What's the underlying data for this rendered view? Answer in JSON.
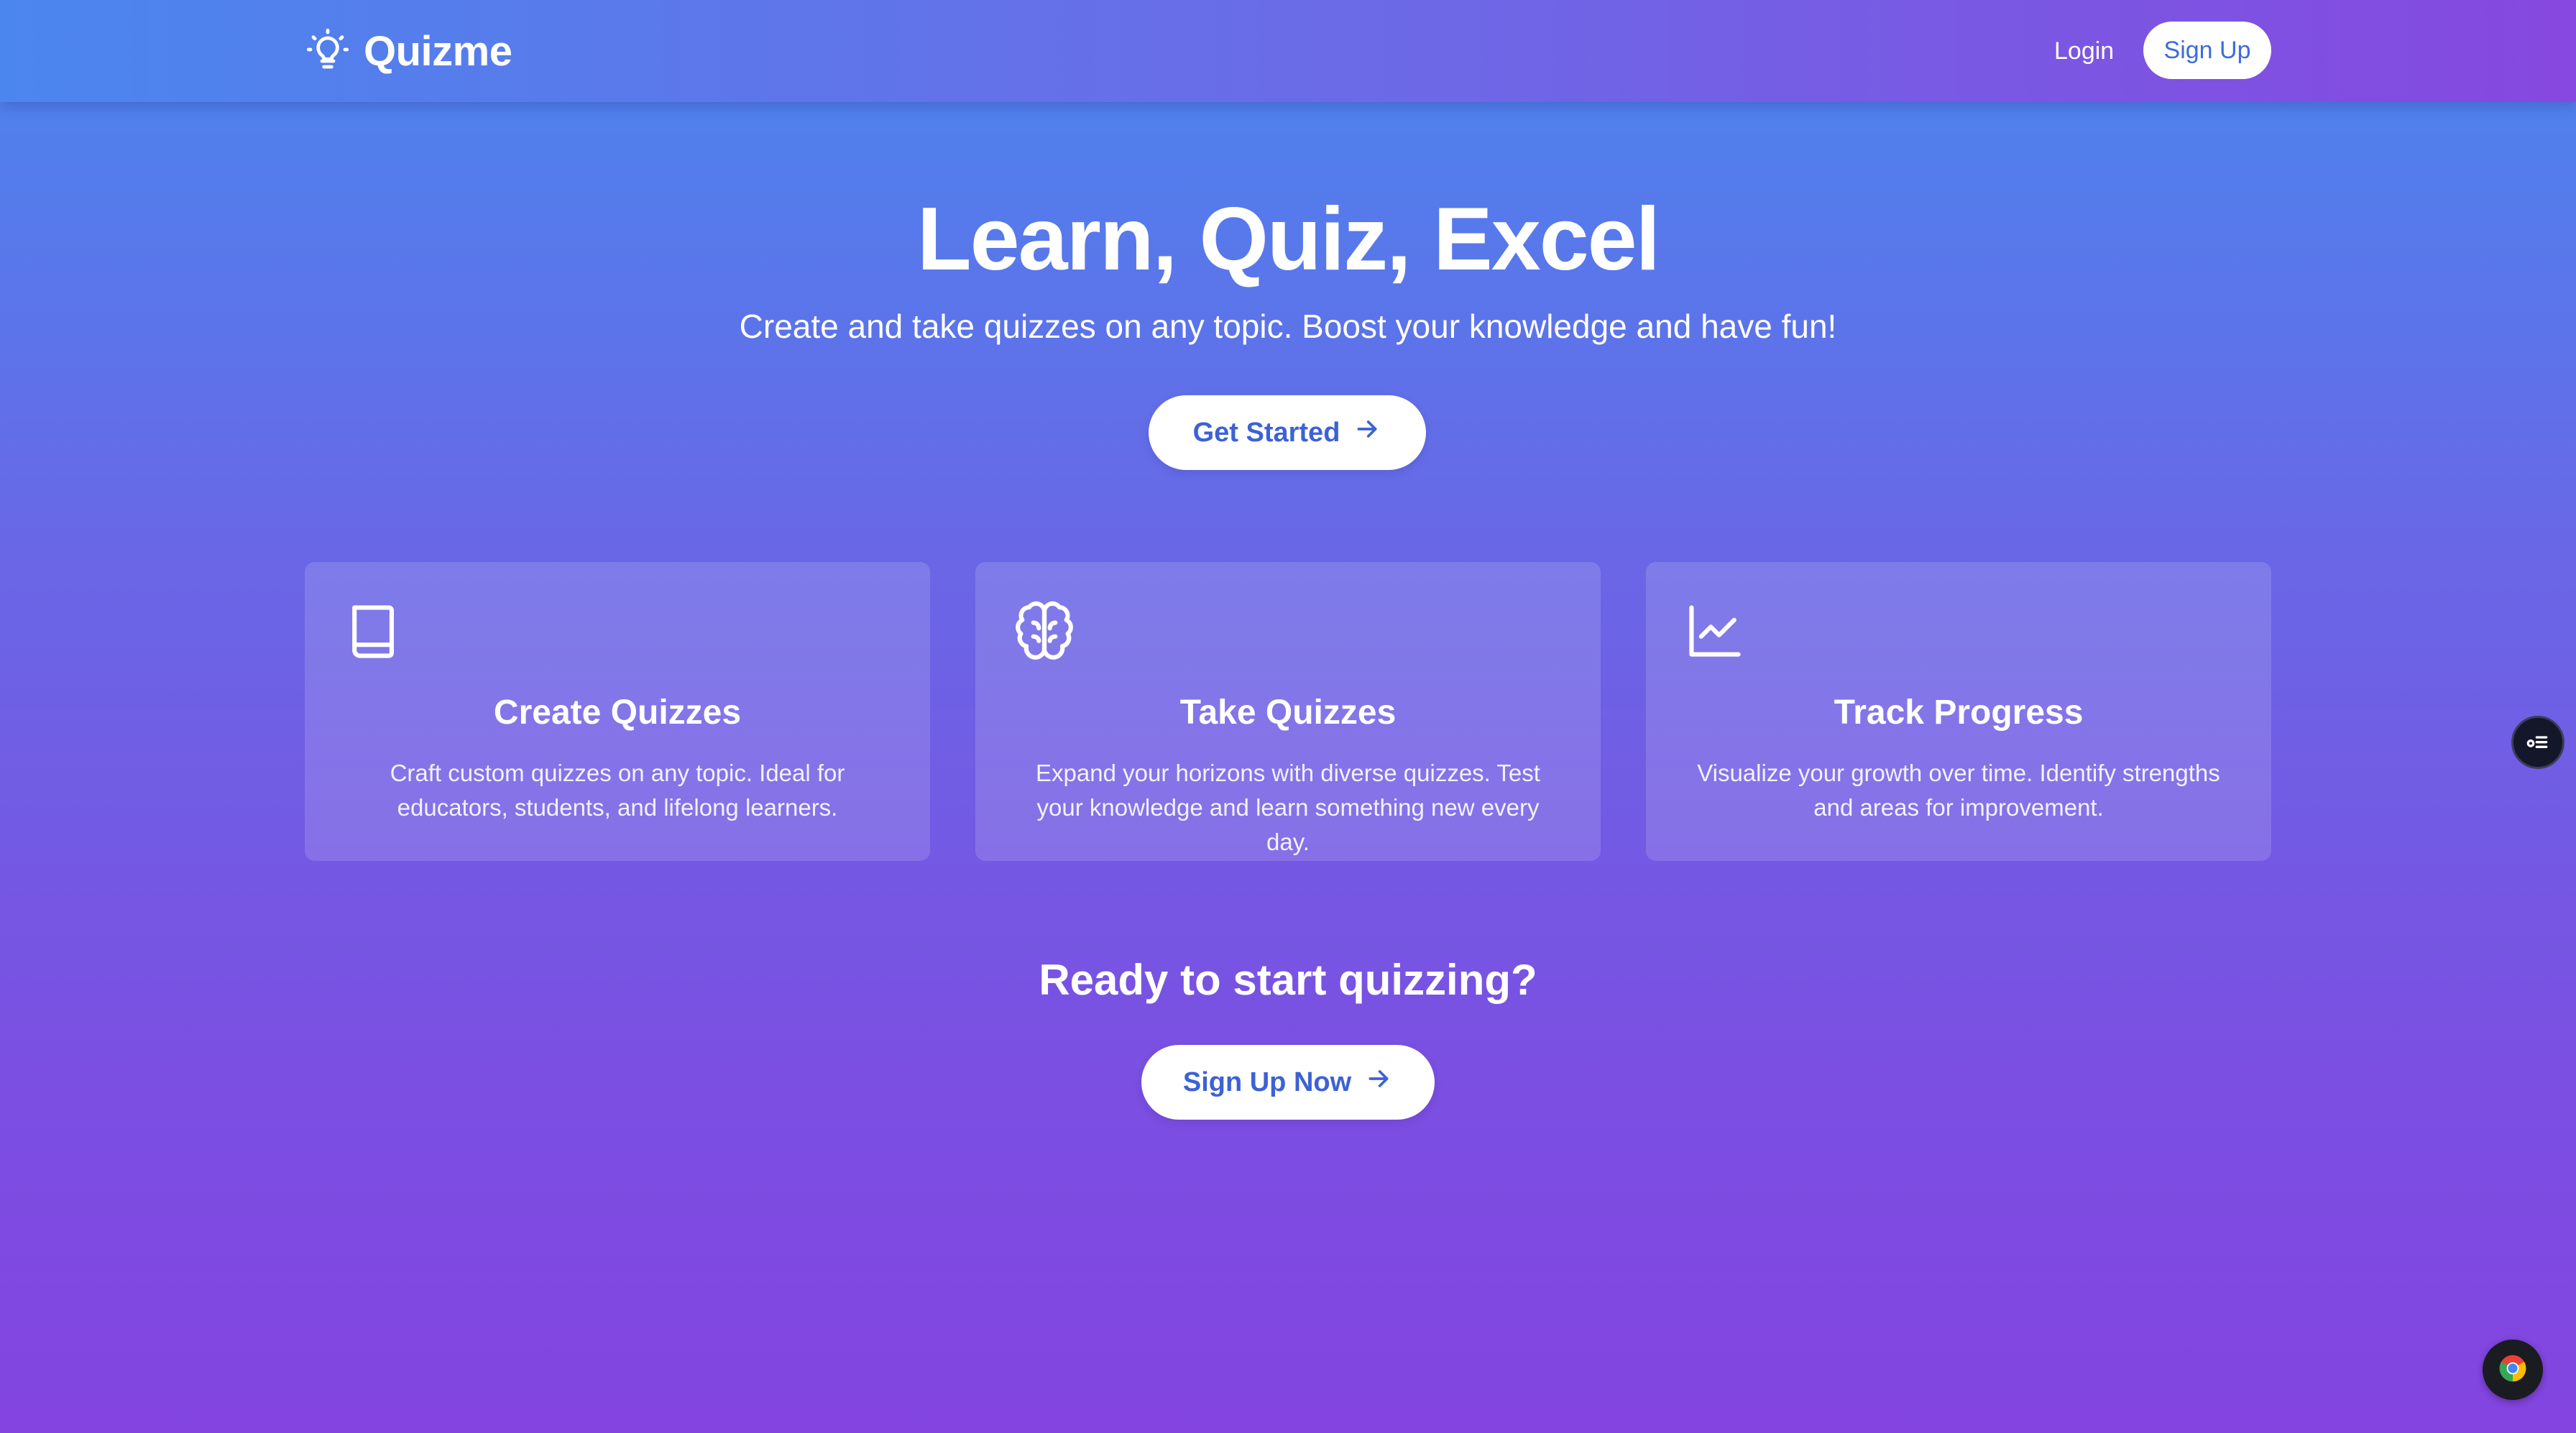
{
  "header": {
    "brand_name": "Quizme",
    "brand_icon": "lightbulb-icon",
    "login_label": "Login",
    "signup_label": "Sign Up"
  },
  "hero": {
    "title": "Learn, Quiz, Excel",
    "subtitle": "Create and take quizzes on any topic. Boost your knowledge and have fun!",
    "cta_label": "Get Started",
    "cta_icon": "arrow-right-icon"
  },
  "features": [
    {
      "icon": "book-icon",
      "title": "Create Quizzes",
      "description": "Craft custom quizzes on any topic. Ideal for educators, students, and lifelong learners."
    },
    {
      "icon": "brain-icon",
      "title": "Take Quizzes",
      "description": "Expand your horizons with diverse quizzes. Test your knowledge and learn something new every day."
    },
    {
      "icon": "line-chart-icon",
      "title": "Track Progress",
      "description": "Visualize your growth over time. Identify strengths and areas for improvement."
    }
  ],
  "cta": {
    "title": "Ready to start quizzing?",
    "button_label": "Sign Up Now",
    "button_icon": "arrow-right-icon"
  },
  "colors": {
    "gradient_top": "#4a86ee",
    "gradient_bottom": "#8344e0",
    "button_text": "#3c62d4",
    "card_bg": "rgba(255,255,255,0.14)"
  },
  "overlays": {
    "side_widget_icon": "extension-menu-icon",
    "corner_widget_icon": "chrome-icon"
  }
}
